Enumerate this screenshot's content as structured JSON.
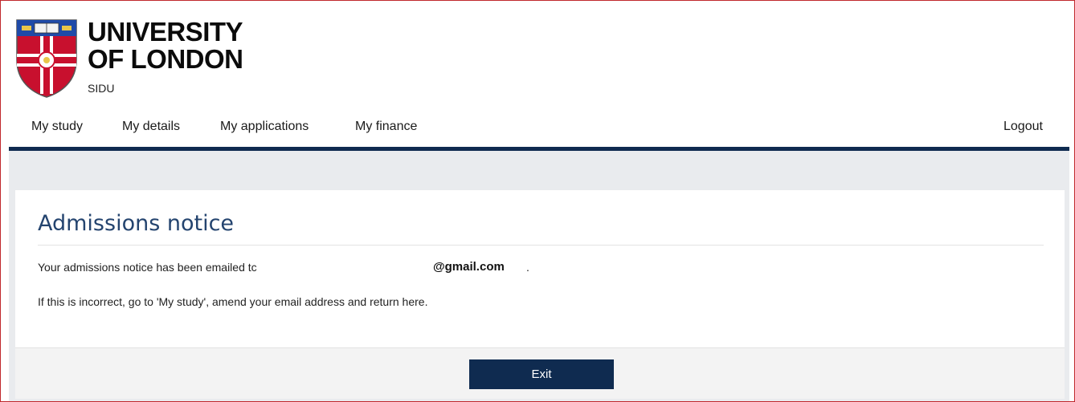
{
  "brand": {
    "line1": "UNIVERSITY",
    "line2": "OF LONDON",
    "sub": "SIDU"
  },
  "nav": {
    "items": [
      {
        "label": "My study"
      },
      {
        "label": "My details"
      },
      {
        "label": "My applications"
      },
      {
        "label": "My finance"
      }
    ],
    "logout": "Logout"
  },
  "notice": {
    "title": "Admissions notice",
    "line1": "Your admissions notice has been emailed tc",
    "email": "@gmail.com",
    "email_suffix": ".",
    "line2": "If this is incorrect, go to 'My study', amend your email address and return here."
  },
  "footer": {
    "exit_label": "Exit"
  },
  "colors": {
    "navy": "#0f2b50",
    "title_blue": "#24446f",
    "crest_red": "#c8102e"
  },
  "icons": {
    "logo": "university-crest-icon"
  }
}
